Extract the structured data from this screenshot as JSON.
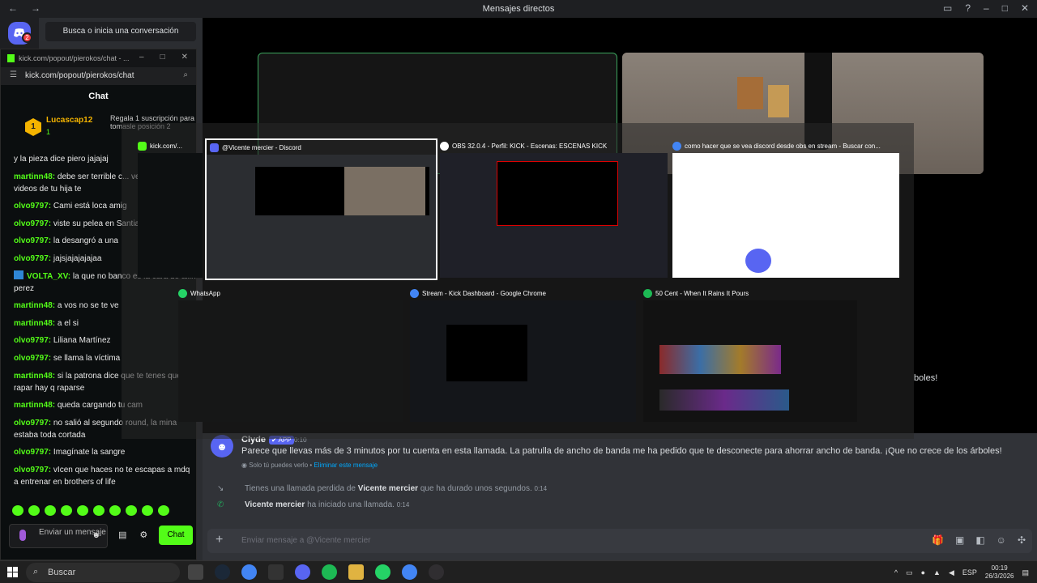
{
  "titlebar": {
    "nav_back": "←",
    "nav_forward": "→",
    "title": "Mensajes directos"
  },
  "rail": {
    "discord_badge": "2"
  },
  "dm_sidebar": {
    "search_label": "Busca o inicia una conversación"
  },
  "kick": {
    "window_title": "kick.com/popout/pierokos/chat - ...",
    "url": "kick.com/popout/pierokos/chat",
    "chat_header": "Chat",
    "gift": {
      "user": "Lucascap12",
      "count": "1",
      "text": "Regala 1 suscripción para tomasle posición 2"
    },
    "messages": [
      {
        "user": "",
        "text": "y la pieza dice piero jajajaj"
      },
      {
        "user": "martinn48:",
        "text": " debe ser terrible c... vean las fotos o videos de tu hija te",
        "two": true
      },
      {
        "user": "olvo9797:",
        "text": " Cami está loca amig"
      },
      {
        "user": "olvo9797:",
        "text": " viste su pelea en Santiago"
      },
      {
        "user": "olvo9797:",
        "text": " la desangró a una"
      },
      {
        "user": "olvo9797:",
        "text": " jajsjajajajajaa"
      },
      {
        "user": "VOLTA_XV:",
        "text": " la que no banco es la cara de ailin perez",
        "two": true,
        "volta": true
      },
      {
        "user": "martinn48:",
        "text": " a vos no se te ve"
      },
      {
        "user": "martinn48:",
        "text": " a el si"
      },
      {
        "user": "olvo9797:",
        "text": " Liliana Martínez"
      },
      {
        "user": "olvo9797:",
        "text": " se llama la víctima"
      },
      {
        "user": "martinn48:",
        "text": " si la patrona dice que te tenes que rapar hay q raparse",
        "two": true
      },
      {
        "user": "martinn48:",
        "text": " queda cargando tu cam"
      },
      {
        "user": "olvo9797:",
        "text": " no salió al segundo round, la mina estaba toda cortada",
        "two": true
      },
      {
        "user": "olvo9797:",
        "text": " Imagínate la sangre"
      },
      {
        "user": "olvo9797:",
        "text": " vIcen que haces no te escapas a mdq a entrenar en brothers of life",
        "two": true
      }
    ],
    "input_placeholder": "Enviar un mensaje",
    "chat_button": "Chat"
  },
  "taskview": {
    "kick_tile_title": "kick.com/...",
    "discord_tile_title": "@Vicente mercier - Discord",
    "obs_tile_title": "OBS 32.0.4 - Perfil: KICK - Escenas: ESCENAS KICK",
    "chrome_search_title": "como hacer que se vea discord desde obs en stream - Buscar con...",
    "whatsapp_title": "WhatsApp",
    "kick_dash_title": "Stream - Kick Dashboard - Google Chrome",
    "spotify_title": "50 Cent - When It Rains It Pours"
  },
  "chat": {
    "clyde": {
      "name": "Clyde",
      "tag": "✔ APP",
      "time": "0:10",
      "body": "Parece que llevas más de 3 minutos por tu cuenta en esta llamada. La patrulla de ancho de banda me ha pedido que te desconecte para ahorrar ancho de banda. ¡Que no crece de los árboles!",
      "note": "Solo tú puedes verlo",
      "note_sep": " • ",
      "note_link": "Eliminar este mensaje"
    },
    "missed_call": {
      "pre": "Tienes una llamada perdida de ",
      "user": "Vicente mercier",
      "post": " que ha durado unos segundos.",
      "time": "0:14"
    },
    "started_call": {
      "user": "Vicente mercier",
      "post": " ha iniciado una llamada.",
      "time": "0:14"
    },
    "input_placeholder": "Enviar mensaje a @Vicente mercier",
    "bleed_text": "boles!"
  },
  "taskbar": {
    "search": "Buscar",
    "lang": "ESP",
    "time": "00:19",
    "date": "26/3/2026"
  }
}
